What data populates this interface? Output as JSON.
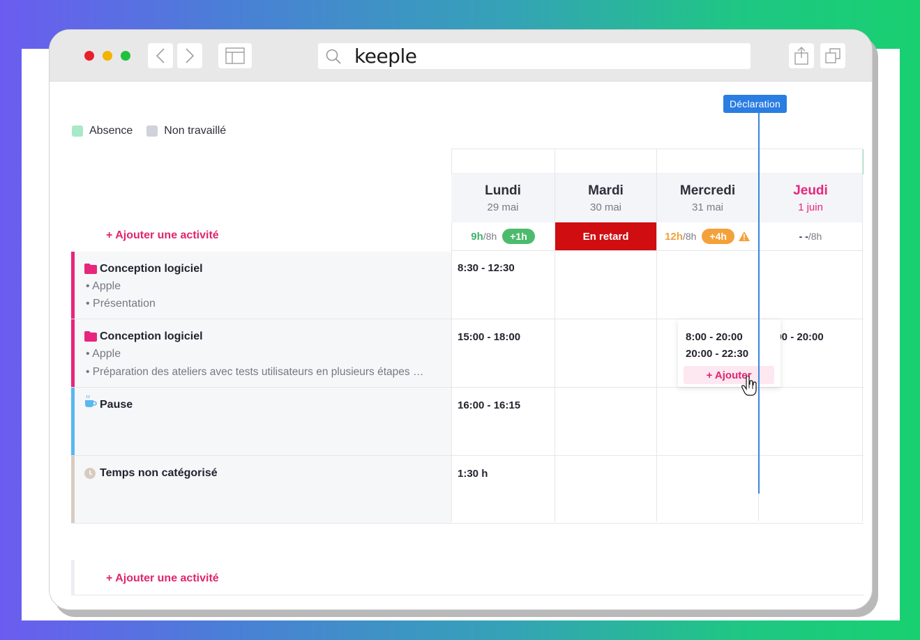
{
  "browser": {
    "brand": "keeple",
    "controls": [
      "close",
      "minimize",
      "maximize"
    ],
    "buttons": [
      "back-icon",
      "forward-icon",
      "sidebar-icon",
      "share-icon",
      "tabs-icon"
    ]
  },
  "legend": [
    {
      "label": "Absence",
      "color": "#a8e9c6"
    },
    {
      "label": "Non travaillé",
      "color": "#cfd2d8"
    }
  ],
  "declaration_label": "Déclaration",
  "add_activity_label": "+ Ajouter une activité",
  "days": [
    {
      "name": "Lundi",
      "date": "29 mai"
    },
    {
      "name": "Mardi",
      "date": "30 mai"
    },
    {
      "name": "Mercredi",
      "date": "31 mai"
    },
    {
      "name": "Jeudi",
      "date": "1 juin",
      "today": true
    }
  ],
  "status": {
    "lundi": {
      "hours": "9h",
      "target": "/8h",
      "delta": "+1h"
    },
    "mardi": {
      "label": "En retard"
    },
    "mercredi": {
      "hours": "12h",
      "target": "/8h",
      "delta": "+4h"
    },
    "jeudi": {
      "hours": "- -",
      "target": " /8h"
    }
  },
  "activities": [
    {
      "title": "Conception logiciel",
      "icon": "folder-icon",
      "color": "#e8257c",
      "subs": [
        "• Apple",
        "• Présentation"
      ],
      "lundi": "8:30 - 12:30"
    },
    {
      "title": "Conception logiciel",
      "icon": "folder-icon",
      "color": "#e8257c",
      "subs": [
        "• Apple",
        "•  Préparation des ateliers avec tests utilisateurs en plusieurs étapes …"
      ],
      "lundi": "15:00 - 18:00",
      "mercredi": [
        "8:00 - 20:00",
        "20:00 - 22:30"
      ],
      "mercredi_add": "+ Ajouter",
      "jeudi": "8:00 - 20:00"
    },
    {
      "title": "Pause",
      "icon": "coffee-icon",
      "color": "#5ab7f0",
      "lundi": "16:00 - 16:15"
    },
    {
      "title": "Temps non catégorisé",
      "icon": "clock-icon",
      "color": "#d8ccc0",
      "lundi": "1:30 h"
    }
  ]
}
